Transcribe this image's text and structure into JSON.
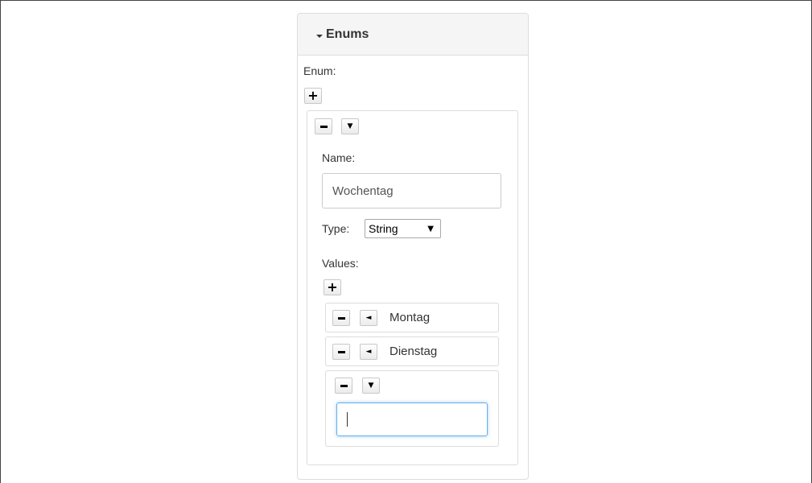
{
  "panel": {
    "title": "Enums"
  },
  "enum_section": {
    "label": "Enum:"
  },
  "enum_item": {
    "name_label": "Name:",
    "name_value": "Wochentag",
    "type_label": "Type:",
    "type_selected": "String",
    "values_label": "Values:",
    "values": [
      {
        "text": "Montag",
        "collapsed": true
      },
      {
        "text": "Dienstag",
        "collapsed": true
      },
      {
        "text": "",
        "collapsed": false
      }
    ]
  },
  "icons": {
    "plus": "+",
    "triangle_down": "▼",
    "triangle_left": "◄",
    "select_arrow": "▼"
  },
  "colors": {
    "focus_border": "#66afe9",
    "panel_heading_bg": "#f5f5f5"
  }
}
